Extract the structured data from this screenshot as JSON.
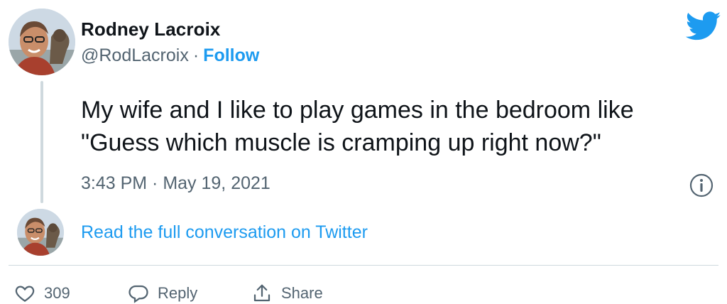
{
  "author": {
    "name": "Rodney Lacroix",
    "handle": "@RodLacroix",
    "separator": "·",
    "follow_label": "Follow"
  },
  "tweet": {
    "text_line1": "My wife and I like to play games in the bedroom like",
    "text_line2": "\"Guess which muscle is cramping up right now?\"",
    "timestamp": "3:43 PM · May 19, 2021"
  },
  "conversation": {
    "link_label": "Read the full conversation on Twitter"
  },
  "actions": {
    "like_count": "309",
    "reply_label": "Reply",
    "share_label": "Share"
  },
  "icons": {
    "brand": "twitter-bird-icon",
    "info": "info-icon",
    "like": "heart-icon",
    "reply": "reply-bubble-icon",
    "share": "share-icon"
  },
  "colors": {
    "accent": "#1d9bf0",
    "text": "#0f1419",
    "secondary_text": "#536471",
    "divider": "#cfd9de"
  }
}
